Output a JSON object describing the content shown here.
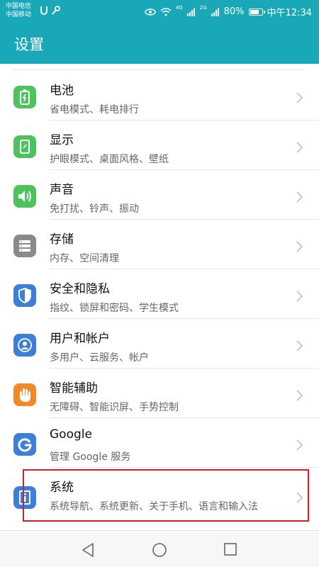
{
  "status_bar": {
    "carrier_1": "中国电信",
    "carrier_2": "中国移动",
    "net_4g": "4G",
    "net_2g": "2G",
    "battery": "80%",
    "battery_level": 0.8,
    "time": "中午12:34"
  },
  "header": {
    "title": "设置"
  },
  "settings": [
    {
      "title": "电池",
      "subtitle": "省电模式、耗电排行",
      "icon": "battery-icon",
      "color": "#4cc35d"
    },
    {
      "title": "显示",
      "subtitle": "护眼模式、桌面风格、壁纸",
      "icon": "display-icon",
      "color": "#4cc35d"
    },
    {
      "title": "声音",
      "subtitle": "免打扰、铃声、振动",
      "icon": "sound-icon",
      "color": "#4cc35d"
    },
    {
      "title": "存储",
      "subtitle": "内存、空间清理",
      "icon": "storage-icon",
      "color": "#8a8a8a"
    },
    {
      "title": "安全和隐私",
      "subtitle": "指纹、锁屏和密码、学生模式",
      "icon": "shield-icon",
      "color": "#3d7fd8"
    },
    {
      "title": "用户和帐户",
      "subtitle": "多用户、云服务、帐户",
      "icon": "user-icon",
      "color": "#3d7fd8"
    },
    {
      "title": "智能辅助",
      "subtitle": "无障碍、智能识屏、手势控制",
      "icon": "hand-icon",
      "color": "#f08a24"
    },
    {
      "title": "Google",
      "subtitle": "管理 Google 服务",
      "icon": "google-icon",
      "color": "#3d7fd8"
    },
    {
      "title": "系统",
      "subtitle": "系统导航、系统更新、关于手机、语言和输入法",
      "icon": "info-icon",
      "color": "#3d7fd8"
    }
  ],
  "nav": {
    "back_icon": "back-triangle-icon",
    "home_icon": "home-circle-icon",
    "recents_icon": "recents-square-icon"
  },
  "highlight_color": "#d81b28"
}
